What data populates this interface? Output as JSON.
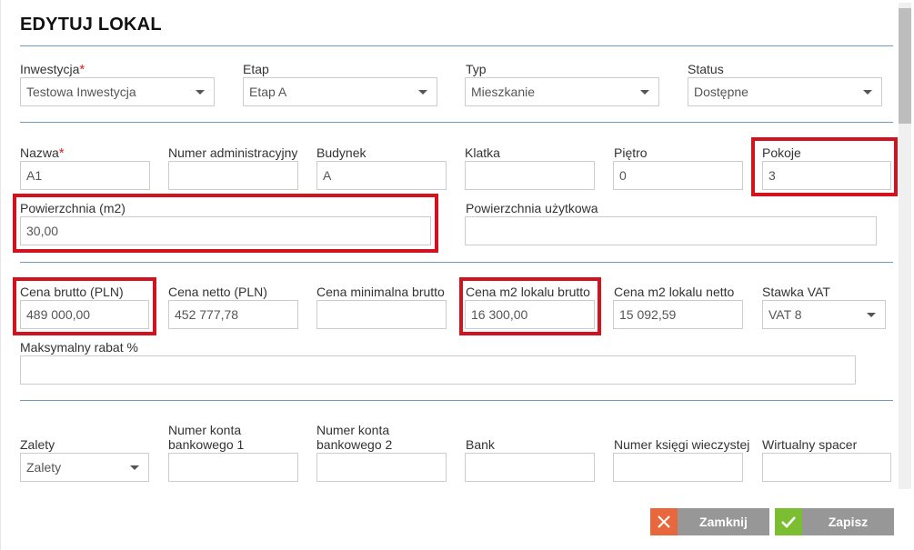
{
  "title": "EDYTUJ LOKAL",
  "required_mark": "*",
  "row1": {
    "inwestycja": {
      "label": "Inwestycja",
      "value": "Testowa Inwestycja"
    },
    "etap": {
      "label": "Etap",
      "value": "Etap A"
    },
    "typ": {
      "label": "Typ",
      "value": "Mieszkanie"
    },
    "status": {
      "label": "Status",
      "value": "Dostępne"
    }
  },
  "row2": {
    "nazwa": {
      "label": "Nazwa",
      "value": "A1"
    },
    "numer_admin": {
      "label": "Numer administracyjny",
      "value": ""
    },
    "budynek": {
      "label": "Budynek",
      "value": "A"
    },
    "klatka": {
      "label": "Klatka",
      "value": ""
    },
    "pietro": {
      "label": "Piętro",
      "value": "0"
    },
    "pokoje": {
      "label": "Pokoje",
      "value": "3"
    }
  },
  "row3": {
    "powierzchnia": {
      "label": "Powierzchnia (m2)",
      "value": "30,00"
    },
    "powierzchnia_uzytkowa": {
      "label": "Powierzchnia użytkowa",
      "value": ""
    }
  },
  "row4": {
    "cena_brutto": {
      "label": "Cena brutto (PLN)",
      "value": "489 000,00"
    },
    "cena_netto": {
      "label": "Cena netto (PLN)",
      "value": "452 777,78"
    },
    "cena_min_brutto": {
      "label": "Cena minimalna brutto",
      "value": ""
    },
    "cena_m2_brutto": {
      "label": "Cena m2 lokalu brutto",
      "value": "16 300,00"
    },
    "cena_m2_netto": {
      "label": "Cena m2 lokalu netto",
      "value": "15 092,59"
    },
    "stawka_vat": {
      "label": "Stawka VAT",
      "value": "VAT 8"
    }
  },
  "row5": {
    "maks_rabat": {
      "label": "Maksymalny rabat %",
      "value": ""
    }
  },
  "row6": {
    "zalety": {
      "label": "Zalety",
      "value": "Zalety"
    },
    "konto1": {
      "label": "Numer konta bankowego 1",
      "value": ""
    },
    "konto2": {
      "label": "Numer konta bankowego 2",
      "value": ""
    },
    "bank": {
      "label": "Bank",
      "value": ""
    },
    "ksiega": {
      "label": "Numer księgi wieczystej",
      "value": ""
    },
    "spacer": {
      "label": "Wirtualny spacer",
      "value": ""
    }
  },
  "buttons": {
    "close": "Zamknij",
    "save": "Zapisz"
  },
  "colors": {
    "highlight": "#d2121f",
    "divider": "#6e9bc6",
    "close_icon_bg": "#e8673c",
    "save_icon_bg": "#7cbe31",
    "button_bg": "#979797"
  },
  "icons": {
    "close": "close-x-icon",
    "save": "checkmark-icon",
    "dropdown": "caret-down-icon"
  }
}
